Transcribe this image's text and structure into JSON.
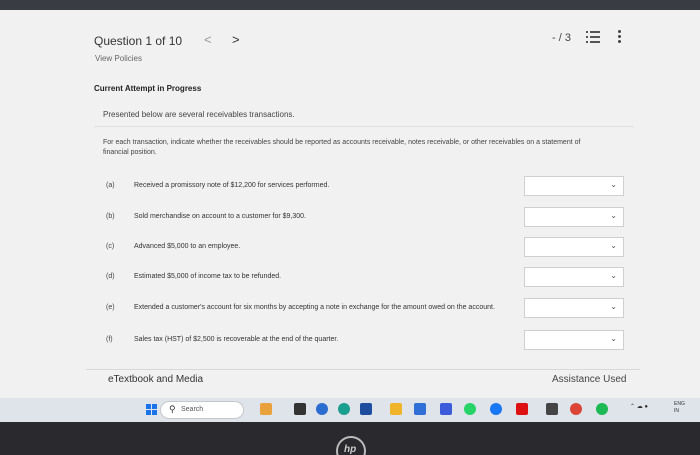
{
  "header": {
    "question_label": "Question 1 of 10",
    "prev_glyph": "<",
    "next_glyph": ">",
    "score": "- / 3"
  },
  "view_policies": "View Policies",
  "attempt_label": "Current Attempt in Progress",
  "intro": "Presented below are several receivables transactions.",
  "instructions": "For each transaction, indicate whether the receivables should be reported as accounts receivable, notes receivable, or other receivables on a statement of financial position.",
  "rows": [
    {
      "letter": "(a)",
      "text": "Received a promissory note of $12,200 for services performed."
    },
    {
      "letter": "(b)",
      "text": "Sold merchandise on account to a customer for $9,300."
    },
    {
      "letter": "(c)",
      "text": "Advanced $5,000 to an employee."
    },
    {
      "letter": "(d)",
      "text": "Estimated $5,000 of income tax to be refunded."
    },
    {
      "letter": "(e)",
      "text": "Extended a customer's account for six months by accepting a note in exchange for the amount owed on the account."
    },
    {
      "letter": "(f)",
      "text": "Sales tax (HST) of $2,500 is recoverable at the end of the quarter."
    }
  ],
  "footer": {
    "etextbook": "eTextbook and Media",
    "assistance": "Assistance Used"
  },
  "taskbar": {
    "search_label": "Search",
    "lang_line1": "ENG",
    "lang_line2": "IN"
  },
  "bezel": {
    "logo": "hp"
  },
  "colors": {
    "screen_bg": "#f1f1f1",
    "taskbar_bg": "#dfe3ea",
    "bezel": "#2a2a2e",
    "windows_blue": "#1a73e8"
  },
  "icons": [
    "list-icon",
    "more-vertical-icon",
    "chevron-down-icon",
    "search-icon",
    "windows-icon"
  ]
}
